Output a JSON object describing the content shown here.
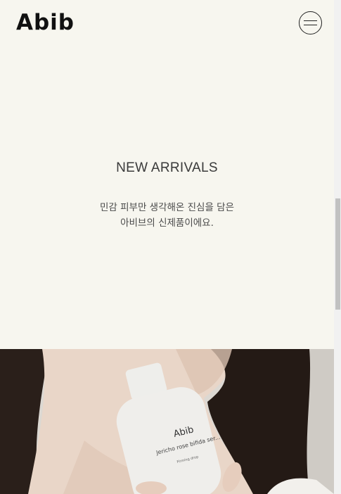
{
  "header": {
    "logo": "Abib",
    "menu_icon": "hamburger-circle-icon"
  },
  "hero": {
    "title": "NEW ARRIVALS",
    "desc_line1": "민감 피부만 생각해온 진심을 담은",
    "desc_line2": "아비브의 신제품이에요."
  },
  "product": {
    "bottle_brand": "Abib",
    "bottle_name": "Jericho rose bifida ser...",
    "bottle_sub": "Firming drop"
  },
  "colors": {
    "background": "#f7f6ef",
    "text": "#3a3a3a"
  }
}
